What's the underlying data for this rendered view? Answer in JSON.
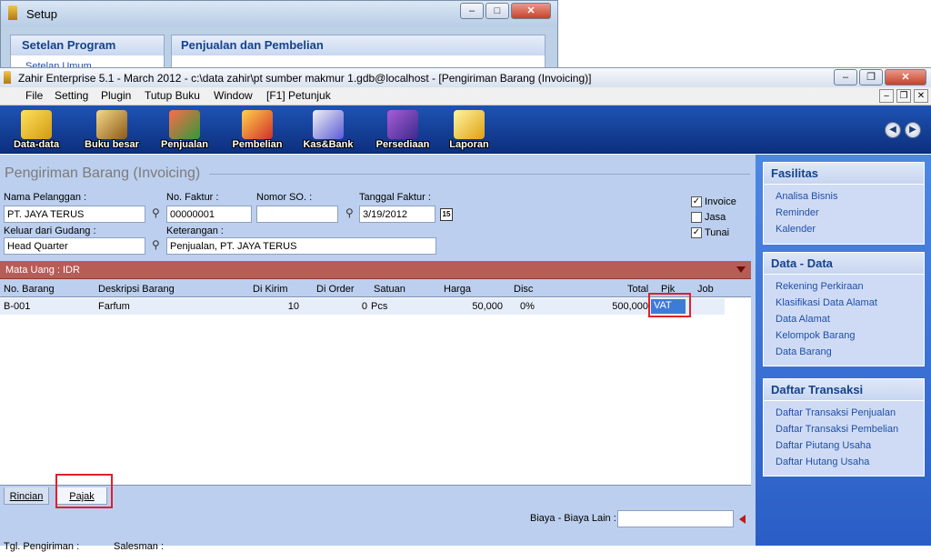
{
  "setup_window": {
    "title": "Setup",
    "left_panel_title": "Setelan Program",
    "left_panel_link": "Setelan Umum",
    "right_panel_title": "Penjualan dan Pembelian"
  },
  "main_window": {
    "title": "Zahir Enterprise 5.1 - March 2012 - c:\\data zahir\\pt sumber makmur 1.gdb@localhost - [Pengiriman Barang (Invoicing)]"
  },
  "menu": {
    "items": [
      "File",
      "Setting",
      "Plugin",
      "Tutup Buku",
      "Window",
      "[F1] Petunjuk"
    ]
  },
  "toolbar": {
    "buttons": [
      {
        "label": "Data-data",
        "icon": "data-data-icon"
      },
      {
        "label": "Buku besar",
        "icon": "ledger-icon"
      },
      {
        "label": "Penjualan",
        "icon": "sales-icon"
      },
      {
        "label": "Pembelian",
        "icon": "purchase-icon"
      },
      {
        "label": "Kas&Bank",
        "icon": "cash-bank-icon"
      },
      {
        "label": "Persediaan",
        "icon": "inventory-icon"
      },
      {
        "label": "Laporan",
        "icon": "report-icon"
      }
    ]
  },
  "form": {
    "title": "Pengiriman Barang (Invoicing)",
    "customer_label": "Nama Pelanggan :",
    "customer_value": "PT. JAYA TERUS",
    "invoice_no_label": "No. Faktur :",
    "invoice_no_value": "00000001",
    "so_no_label": "Nomor SO. :",
    "so_no_value": "",
    "invoice_date_label": "Tanggal Faktur :",
    "invoice_date_value": "3/19/2012",
    "calendar_btn": "15",
    "warehouse_label": "Keluar dari Gudang :",
    "warehouse_value": "Head Quarter",
    "notes_label": "Keterangan :",
    "notes_value": "Penjualan, PT. JAYA TERUS",
    "checkboxes": [
      {
        "label": "Invoice",
        "checked": true,
        "mark": "✓"
      },
      {
        "label": "Jasa",
        "checked": false,
        "mark": ""
      },
      {
        "label": "Tunai",
        "checked": true,
        "mark": "✓"
      }
    ],
    "currency_label": "Mata Uang : IDR"
  },
  "grid": {
    "headers": [
      "No. Barang",
      "Deskripsi Barang",
      "Di Kirim",
      "Di Order",
      "Satuan",
      "Harga",
      "Disc",
      "Total",
      "Pjk",
      "Job"
    ],
    "row": {
      "no_barang": "B-001",
      "deskripsi": "Farfum",
      "dikirim": "10",
      "diorder": "0",
      "satuan": "Pcs",
      "harga": "50,000",
      "disc": "0%",
      "total": "500,000",
      "pjk": "VAT",
      "job": ""
    }
  },
  "tabs": [
    "Rincian",
    "Pajak"
  ],
  "footer": {
    "other_cost_label": "Biaya - Biaya Lain :",
    "other_cost_value": "",
    "ship_date_label": "Tgl. Pengiriman :",
    "salesman_label": "Salesman :"
  },
  "side_panels": [
    {
      "title": "Fasilitas",
      "links": [
        "Analisa Bisnis",
        "Reminder",
        "Kalender"
      ]
    },
    {
      "title": "Data - Data",
      "links": [
        "Rekening Perkiraan",
        "Klasifikasi Data Alamat",
        "Data Alamat",
        "Kelompok Barang",
        "Data Barang"
      ]
    },
    {
      "title": "Daftar Transaksi",
      "links": [
        "Daftar Transaksi Penjualan",
        "Daftar Transaksi Pembelian",
        "Daftar Piutang Usaha",
        "Daftar Hutang Usaha"
      ]
    }
  ],
  "colors": {
    "toolbar": "#1e53b4",
    "form_bg": "#bccfee",
    "currency_bar": "#b85c56",
    "side_panel": "#4d87e3",
    "highlight": "#e0202a"
  },
  "caption_glyphs": {
    "minimize": "–",
    "maximize": "□",
    "close": "✕",
    "restore": "❐",
    "prev": "◀",
    "next": "▶"
  }
}
